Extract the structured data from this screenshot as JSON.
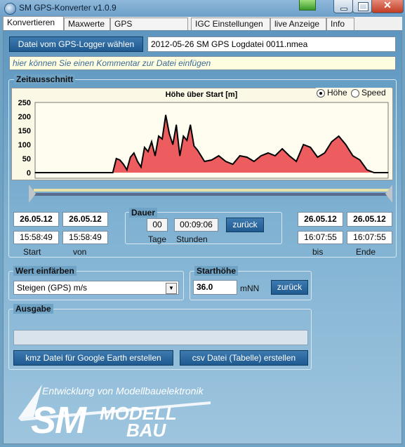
{
  "window": {
    "title": "SM GPS-Konverter v1.0.9"
  },
  "tabs": [
    "Konvertieren",
    "Maxwerte",
    "GPS Einstellungen",
    "IGC Einstellungen",
    "live Anzeige",
    "Info"
  ],
  "file": {
    "button_label": "Datei vom GPS-Logger wählen",
    "filename": "2012-05-26 SM GPS Logdatei 0011.nmea",
    "comment_placeholder": "hier können Sie einen Kommentar zur Datei einfügen"
  },
  "zeitausschnitt": {
    "legend": "Zeitausschnitt",
    "chart_title": "Höhe über Start [m]",
    "radio_hoehe": "Höhe",
    "radio_speed": "Speed",
    "selected": "Höhe"
  },
  "chart_data": {
    "type": "area",
    "title": "Höhe über Start [m]",
    "yticks": [
      "250",
      "200",
      "150",
      "100",
      "50",
      "0"
    ],
    "ylim": [
      -20,
      250
    ],
    "color": "#e8333a",
    "x": [
      0,
      5,
      10,
      14,
      18,
      20,
      22,
      23,
      24,
      25,
      26,
      27,
      28,
      29,
      30,
      31,
      32,
      33,
      34,
      35,
      36,
      37,
      38,
      39,
      40,
      41,
      42,
      43,
      44,
      45,
      46,
      47,
      48,
      50,
      52,
      54,
      56,
      58,
      60,
      62,
      64,
      66,
      68,
      70,
      72,
      74,
      76,
      78,
      80,
      82,
      84,
      86,
      88,
      90,
      92,
      94,
      96,
      98,
      100
    ],
    "y": [
      0,
      0,
      0,
      0,
      0,
      0,
      0,
      50,
      45,
      30,
      10,
      55,
      70,
      40,
      20,
      90,
      75,
      110,
      60,
      130,
      120,
      205,
      140,
      100,
      170,
      60,
      130,
      115,
      170,
      95,
      80,
      60,
      40,
      45,
      60,
      40,
      30,
      60,
      55,
      40,
      60,
      70,
      60,
      85,
      60,
      40,
      100,
      90,
      55,
      70,
      110,
      130,
      100,
      60,
      45,
      10,
      0,
      0,
      0
    ]
  },
  "dates": {
    "start_date": "26.05.12",
    "start_time": "15:58:49",
    "start_label": "Start",
    "von_date": "26.05.12",
    "von_time": "15:58:49",
    "von_label": "von",
    "bis_date": "26.05.12",
    "bis_time": "16:07:55",
    "bis_label": "bis",
    "ende_date": "26.05.12",
    "ende_time": "16:07:55",
    "ende_label": "Ende"
  },
  "dauer": {
    "legend": "Dauer",
    "tage": "00",
    "stunden": "00:09:06",
    "tage_label": "Tage",
    "stunden_label": "Stunden",
    "zurueck": "zurück"
  },
  "wert": {
    "legend": "Wert einfärben",
    "selected": "Steigen (GPS) m/s"
  },
  "starthoehe": {
    "legend": "Starthöhe",
    "value": "36.0",
    "unit": "mNN",
    "zurueck": "zurück"
  },
  "ausgabe": {
    "legend": "Ausgabe",
    "kmz_button": "kmz Datei für Google Earth erstellen",
    "csv_button": "csv Datei (Tabelle) erstellen"
  },
  "logo": {
    "tagline": "Entwicklung von Modellbauelektronik",
    "sm": "SM",
    "modell": "MODELL",
    "bau": "BAU"
  }
}
